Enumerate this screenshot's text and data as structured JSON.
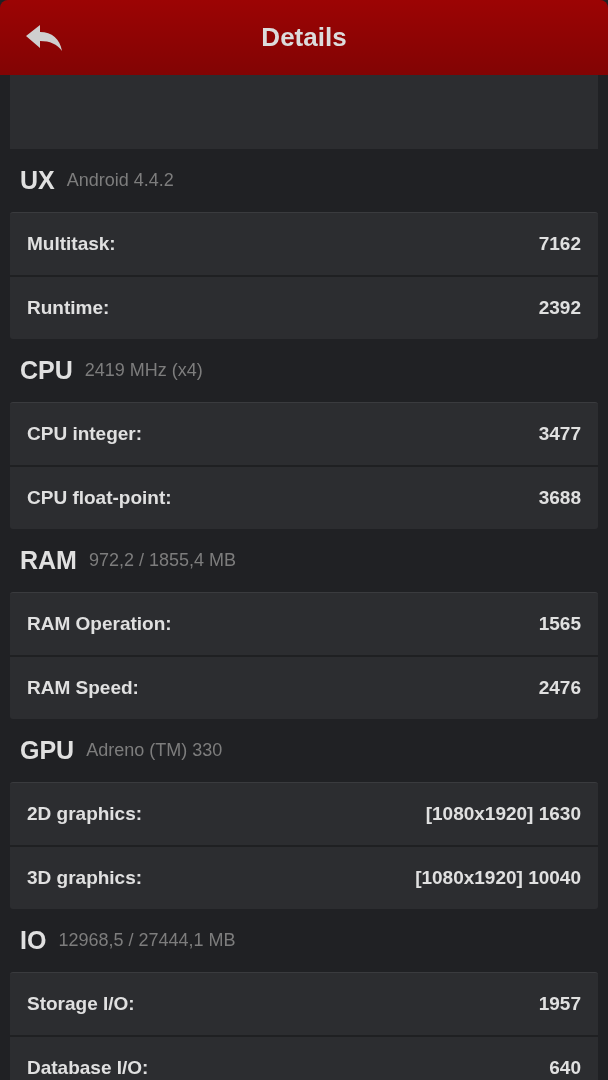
{
  "header": {
    "title": "Details"
  },
  "sections": [
    {
      "name": "UX",
      "info": "Android 4.4.2",
      "rows": [
        {
          "label": "Multitask:",
          "value": "7162"
        },
        {
          "label": "Runtime:",
          "value": "2392"
        }
      ]
    },
    {
      "name": "CPU",
      "info": "2419 MHz (x4)",
      "rows": [
        {
          "label": "CPU integer:",
          "value": "3477"
        },
        {
          "label": "CPU float-point:",
          "value": "3688"
        }
      ]
    },
    {
      "name": "RAM",
      "info": "972,2 / 1855,4 MB",
      "rows": [
        {
          "label": "RAM Operation:",
          "value": "1565"
        },
        {
          "label": "RAM Speed:",
          "value": "2476"
        }
      ]
    },
    {
      "name": "GPU",
      "info": "Adreno (TM) 330",
      "rows": [
        {
          "label": "2D graphics:",
          "value": "[1080x1920] 1630"
        },
        {
          "label": "3D graphics:",
          "value": "[1080x1920] 10040"
        }
      ]
    },
    {
      "name": "IO",
      "info": "12968,5 / 27444,1 MB",
      "rows": [
        {
          "label": "Storage I/O:",
          "value": "1957"
        },
        {
          "label": "Database I/O:",
          "value": "640"
        }
      ]
    }
  ]
}
